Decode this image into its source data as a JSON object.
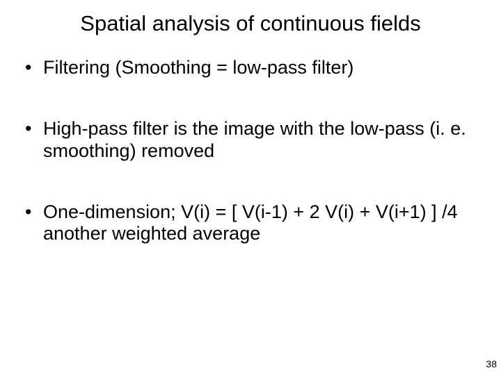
{
  "title": "Spatial analysis of continuous fields",
  "bullets": [
    "Filtering (Smoothing = low-pass filter)",
    "High-pass filter is the image with the low-pass (i. e. smoothing) removed",
    "One-dimension; V(i) = [ V(i-1) + 2 V(i) + V(i+1) ] /4 another weighted average"
  ],
  "page_number": "38"
}
